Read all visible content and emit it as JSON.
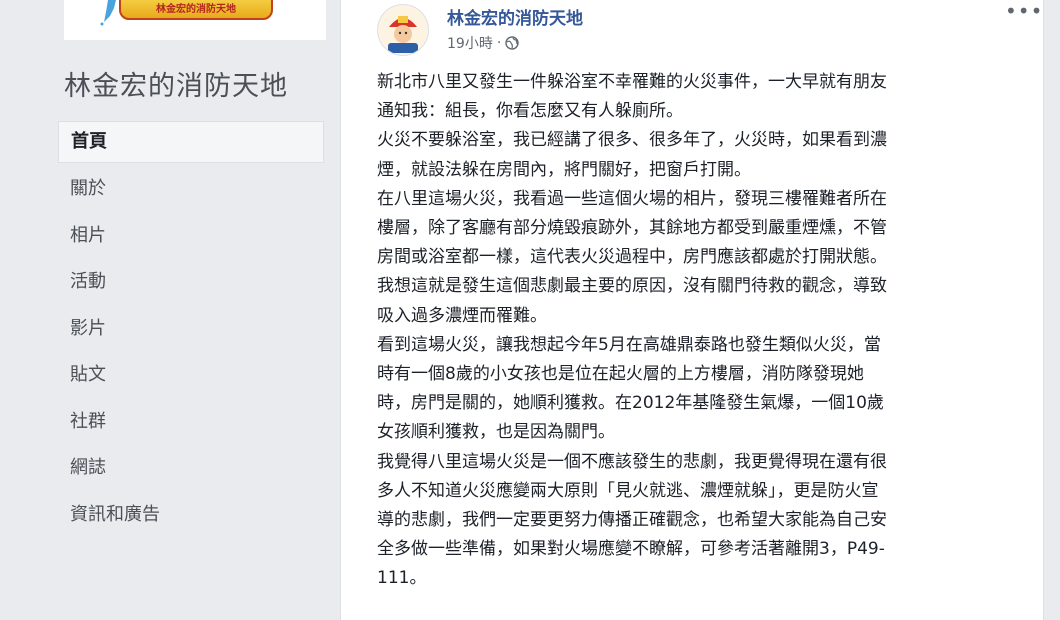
{
  "page": {
    "title": "林金宏的消防天地",
    "cover_banner_text": "林金宏的消防天地"
  },
  "nav": {
    "items": [
      {
        "label": "首頁",
        "active": true
      },
      {
        "label": "關於"
      },
      {
        "label": "相片"
      },
      {
        "label": "活動"
      },
      {
        "label": "影片"
      },
      {
        "label": "貼文"
      },
      {
        "label": "社群"
      },
      {
        "label": "網誌"
      },
      {
        "label": "資訊和廣告"
      }
    ]
  },
  "post": {
    "author": "林金宏的消防天地",
    "time": "19小時",
    "privacy_icon": "globe-icon",
    "more_icon": "more-options-icon",
    "more_label": "•••",
    "lines": [
      "新北市八里又發生一件躲浴室不幸罹難的火災事件，一大早就有朋友",
      "通知我：組長，你看怎麼又有人躲廁所。",
      "火災不要躲浴室，我已經講了很多、很多年了，火災時，如果看到濃",
      "煙，就設法躲在房間內，將門關好，把窗戶打開。",
      "在八里這場火災，我看過一些這個火場的相片，發現三樓罹難者所在",
      "樓層，除了客廳有部分燒毀痕跡外，其餘地方都受到嚴重煙燻，不管",
      "房間或浴室都一樣，這代表火災過程中，房門應該都處於打開狀態。",
      "我想這就是發生這個悲劇最主要的原因，沒有關門待救的觀念，導致",
      "吸入過多濃煙而罹難。",
      "看到這場火災，讓我想起今年5月在高雄鼎泰路也發生類似火災，當",
      "時有一個8歲的小女孩也是位在起火層的上方樓層，消防隊發現她",
      "時，房門是關的，她順利獲救。在2012年基隆發生氣爆，一個10歲",
      "女孩順利獲救，也是因為關門。",
      "我覺得八里這場火災是一個不應該發生的悲劇，我更覺得現在還有很",
      "多人不知道火災應變兩大原則「見火就逃、濃煙就躲」，更是防火宣",
      "導的悲劇，我們一定要更努力傳播正確觀念，也希望大家能為自己安",
      "全多做一些準備，如果對火場應變不瞭解，可參考活著離開3，P49-",
      "111。"
    ]
  }
}
